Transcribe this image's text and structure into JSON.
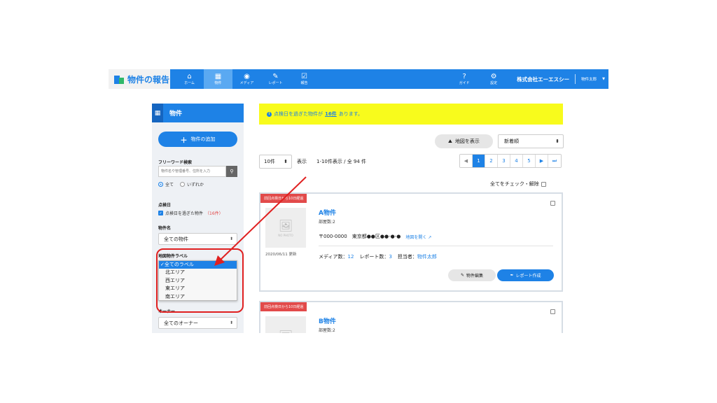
{
  "brand": {
    "title": "物件の報告"
  },
  "nav": [
    {
      "label": "ホーム",
      "icon": "⌂"
    },
    {
      "label": "物件",
      "icon": "▦"
    },
    {
      "label": "メディア",
      "icon": "◉"
    },
    {
      "label": "レポート",
      "icon": "✎"
    },
    {
      "label": "報告",
      "icon": "☑"
    }
  ],
  "nav_right": [
    {
      "label": "ガイド",
      "icon": "?"
    },
    {
      "label": "設定",
      "icon": "⚙"
    }
  ],
  "company": "株式会社エーエスシー",
  "user": "物件太郎",
  "sidebar": {
    "title": "物件",
    "add_button": "物件の追加",
    "freeword_label": "フリーワード検索",
    "search_placeholder": "物件名や管理番号、住所を入力",
    "radio_all": "全て",
    "radio_any": "いずれか",
    "inspection_label": "点検日",
    "overdue_checkbox": "点検日を過ぎた物件",
    "overdue_count": "（16件）",
    "property_name_label": "物件名",
    "property_name_value": "全ての物件",
    "map_label_label": "地図物件ラベル",
    "map_label_options": [
      "全てのラベル",
      "北エリア",
      "西エリア",
      "東エリア",
      "南エリア"
    ],
    "owner_label": "オーナー",
    "owner_value": "全てのオーナー"
  },
  "alert": {
    "pre": "点検日を過ぎた物件が",
    "link": "16件",
    "post": "あります。"
  },
  "toolbar": {
    "map_button": "地図を表示",
    "sort_value": "新着順",
    "per_page_value": "10件",
    "per_page_label": "表示",
    "count_text": "1-10件表示 / 全 94 件",
    "pages": [
      "1",
      "2",
      "3",
      "4",
      "5"
    ],
    "check_all": "全てをチェック・解除"
  },
  "cards": [
    {
      "badge": "前回点検日から10日経過",
      "name": "A物件",
      "rooms": "部屋数:2",
      "postal": "〒000-0000",
      "address": "東京都●●区●●-●-●",
      "map_link": "地図を開く",
      "no_photo": "NO PHOTO",
      "updated": "2020/06/11 更新",
      "media_label": "メディア数：",
      "media_count": "12",
      "report_label": "レポート数：",
      "report_count": "3",
      "owner_label": "担当者：",
      "owner_name": "物件太郎",
      "edit_button": "物件編集",
      "report_button": "レポート作成"
    },
    {
      "badge": "前回点検日から10日経過",
      "name": "B物件",
      "rooms": "部屋数:2"
    }
  ],
  "colors": {
    "primary": "#1e82e6",
    "alert_bg": "#f8fb1c",
    "badge": "#e24a4a",
    "annotation": "#e02020"
  }
}
